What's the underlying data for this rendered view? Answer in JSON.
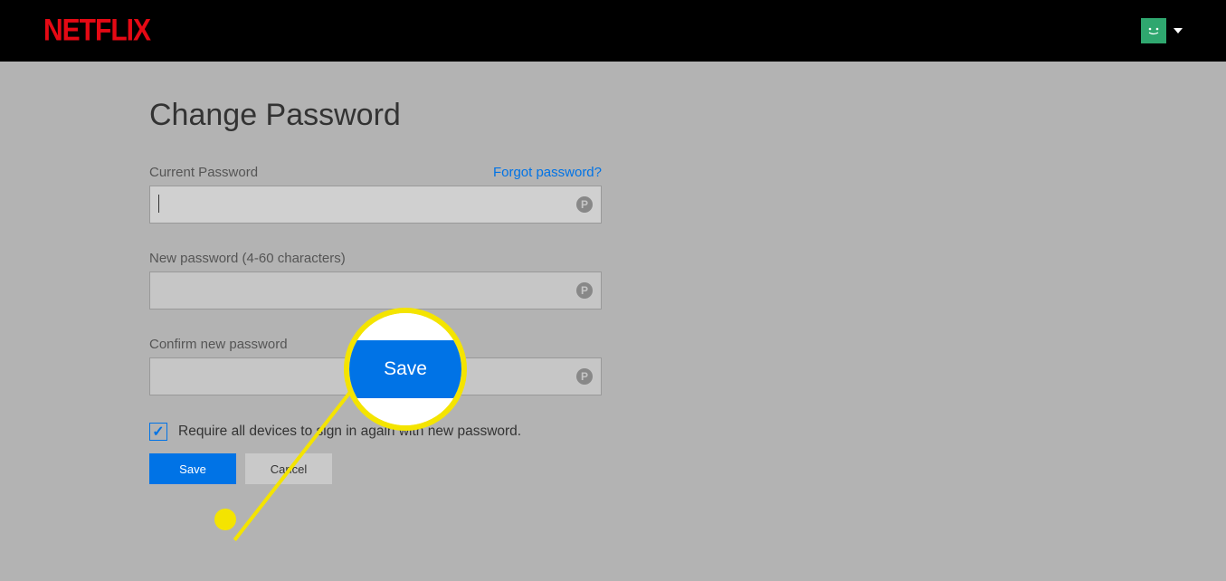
{
  "brand": "NETFLIX",
  "page": {
    "title": "Change Password",
    "forgot_link": "Forgot password?",
    "fields": {
      "current": {
        "label": "Current Password",
        "value": ""
      },
      "new": {
        "label": "New password (4-60 characters)",
        "value": ""
      },
      "confirm": {
        "label": "Confirm new password",
        "value": ""
      }
    },
    "checkbox": {
      "checked": true,
      "label": "Require all devices to sign in again with new password."
    },
    "buttons": {
      "save": "Save",
      "cancel": "Cancel"
    }
  },
  "callout": {
    "button_label": "Save"
  }
}
